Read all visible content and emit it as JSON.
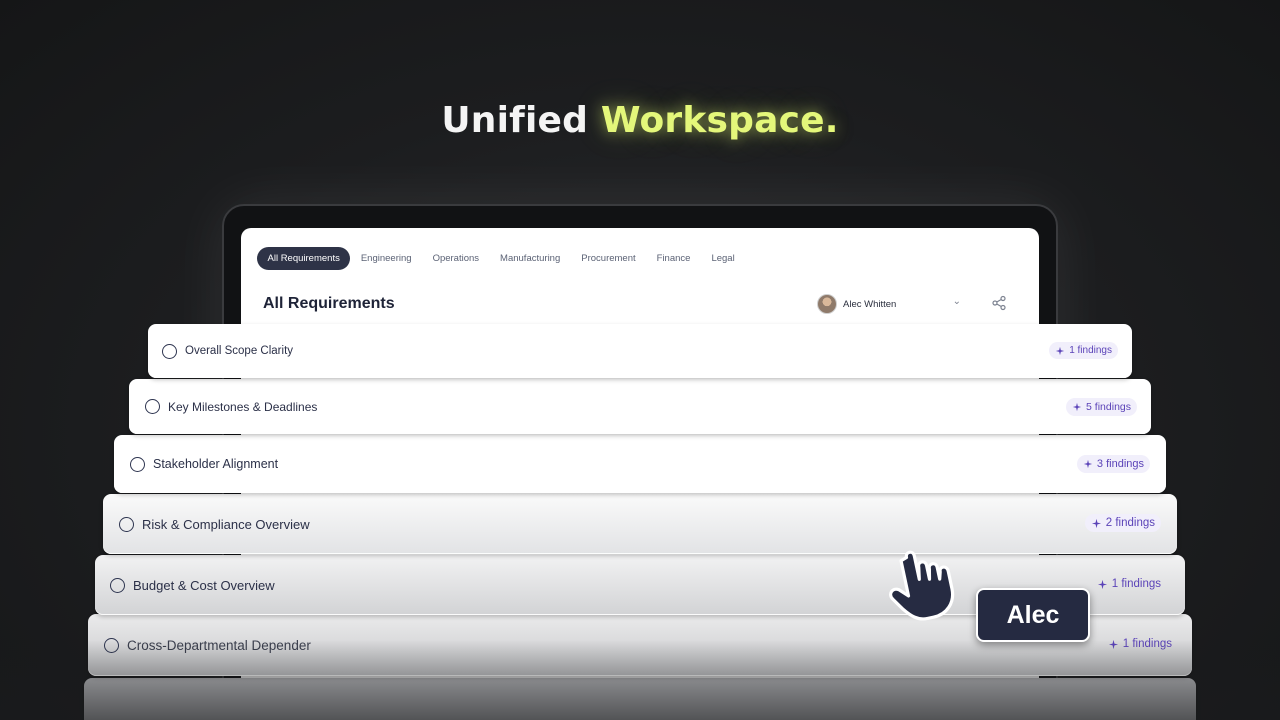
{
  "headline": {
    "part1": "Unified",
    "part2": "Workspace."
  },
  "colors": {
    "accent": "#e4f77a",
    "active_tab": "#2e3347",
    "badge_text": "#5b43b8",
    "tag_bg": "#252a41"
  },
  "tabs": [
    {
      "label": "All Requirements",
      "active": true
    },
    {
      "label": "Engineering"
    },
    {
      "label": "Operations"
    },
    {
      "label": "Manufacturing"
    },
    {
      "label": "Procurement"
    },
    {
      "label": "Finance"
    },
    {
      "label": "Legal"
    }
  ],
  "screen": {
    "title": "All Requirements",
    "user": "Alec Whitten"
  },
  "requirements": [
    {
      "title": "Overall Scope Clarity",
      "findings": "1 findings"
    },
    {
      "title": "Key Milestones & Deadlines",
      "findings": "5 findings"
    },
    {
      "title": "Stakeholder Alignment",
      "findings": "3 findings"
    },
    {
      "title": "Risk & Compliance Overview",
      "findings": "2 findings"
    },
    {
      "title": "Budget & Cost Overview",
      "findings": "1 findings"
    },
    {
      "title": "Cross-Departmental Depender",
      "findings": "1 findings"
    }
  ],
  "cursor_tag": "Alec"
}
